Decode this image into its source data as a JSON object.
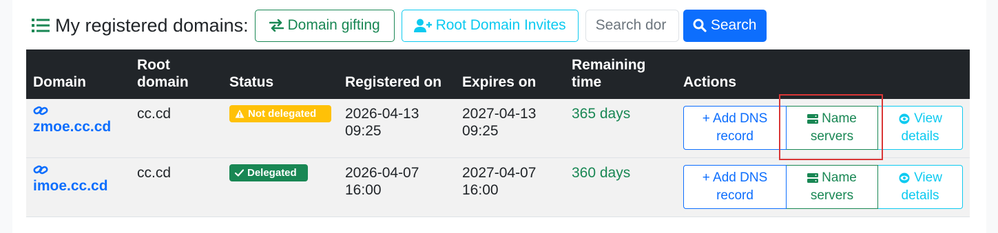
{
  "header": {
    "title": "My registered domains:",
    "title_icon": "list-icon",
    "gifting_label": "Domain gifting",
    "invites_label": "Root Domain Invites",
    "search_placeholder": "Search dor",
    "search_label": "Search"
  },
  "table": {
    "columns": {
      "domain": "Domain",
      "root_1": "Root",
      "root_2": "domain",
      "status": "Status",
      "registered": "Registered on",
      "expires": "Expires on",
      "remaining_1": "Remaining",
      "remaining_2": "time",
      "actions": "Actions"
    },
    "rows": [
      {
        "domain": "zmoe.cc.cd",
        "root": "cc.cd",
        "status": "Not delegated",
        "status_icon": "warning-icon",
        "registered_date": "2026-04-13",
        "registered_time": "09:25",
        "expires_date": "2027-04-13",
        "expires_time": "09:25",
        "remaining": "365 days",
        "actions": {
          "add_dns_1": "+ Add DNS",
          "add_dns_2": "record",
          "ns_1": "Name",
          "ns_2": "servers",
          "view_1": "View",
          "view_2": "details"
        }
      },
      {
        "domain": "imoe.cc.cd",
        "root": "cc.cd",
        "status": "Delegated",
        "status_icon": "check-icon",
        "registered_date": "2026-04-07",
        "registered_time": "16:00",
        "expires_date": "2027-04-07",
        "expires_time": "16:00",
        "remaining": "360 days",
        "actions": {
          "add_dns_1": "+ Add DNS",
          "add_dns_2": "record",
          "ns_1": "Name",
          "ns_2": "servers",
          "view_1": "View",
          "view_2": "details"
        }
      }
    ]
  },
  "colors": {
    "primary": "#0d6efd",
    "success": "#198754",
    "info": "#0dcaf0",
    "warning": "#ffc107",
    "table_header": "#212529",
    "highlight": "#d93636"
  }
}
